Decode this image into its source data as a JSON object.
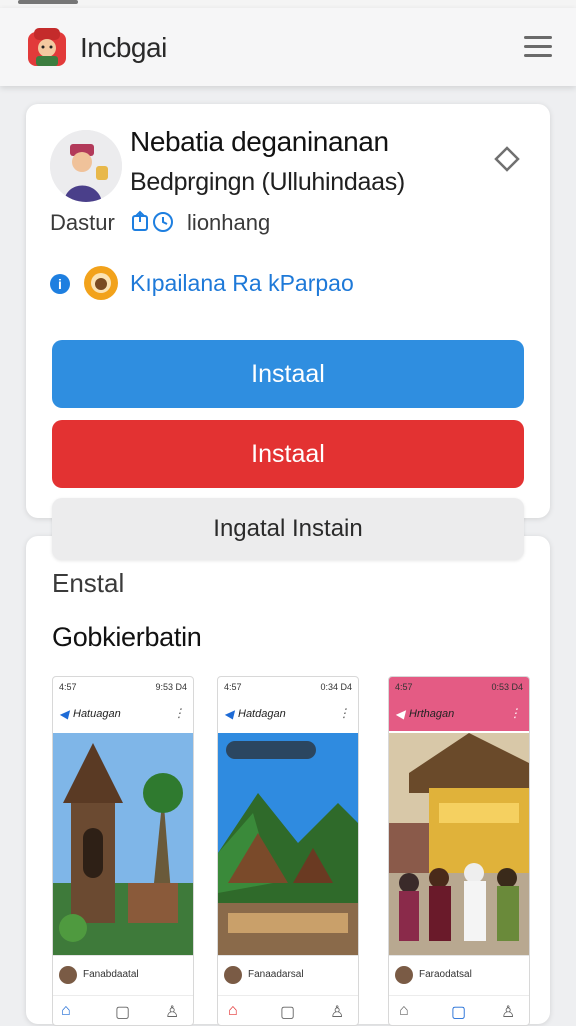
{
  "app_bar": {
    "title": "Incbgai"
  },
  "app": {
    "title": "Nebatia deganinanan",
    "subtitle": "Bedprgingn (Ulluhindaas)",
    "meta_label": "Dastur",
    "version": "lionhang",
    "developer": "Kıpailana Ra kParpao"
  },
  "buttons": {
    "install_primary": "Instaal",
    "install_secondary": "Instaal",
    "install_tertiary": "Ingatal Instain"
  },
  "sections": {
    "first": "Enstal",
    "second": "Gobkierbatin"
  },
  "screenshots": [
    {
      "time": "4:57",
      "status": "9:53 D4",
      "title": "Hatuagan",
      "caption": "Fanabdaatal",
      "header_color": "#f3f3f3"
    },
    {
      "time": "4:57",
      "status": "0:34 D4",
      "title": "Hatdagan",
      "caption": "Fanaadarsal",
      "header_color": "#f3f3f3"
    },
    {
      "time": "4:57",
      "status": "0:53 D4",
      "title": "Hrthagan",
      "caption": "Faraodatsal",
      "header_color": "#e45b84"
    }
  ],
  "colors": {
    "primary_button": "#2f8ee0",
    "danger_button": "#e33232",
    "link": "#1e79d8"
  }
}
